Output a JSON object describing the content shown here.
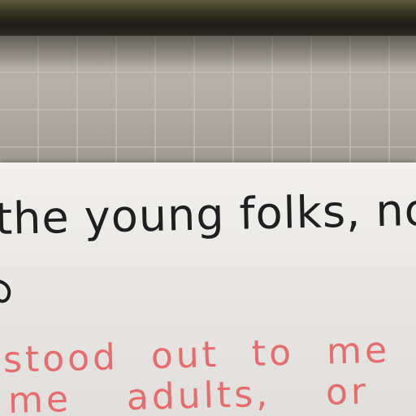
{
  "handwriting": {
    "black_line": "the young folks, not",
    "red_line_1": "stood out to me",
    "red_line_2": "me adults, or th"
  },
  "colors": {
    "black_ink": "#1f1f22",
    "red_ink": "#e86b6e",
    "paper": "#efede9",
    "wall": "#b1ada2"
  },
  "icons": {
    "arrow_mark": "curved-arrow-icon"
  }
}
